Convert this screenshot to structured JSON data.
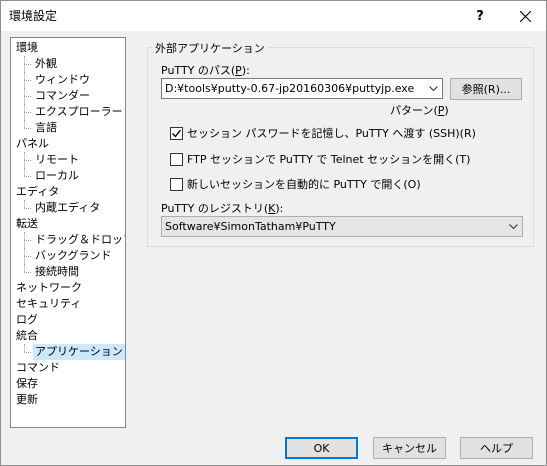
{
  "window": {
    "title": "環境設定",
    "help_glyph": "?"
  },
  "tree": [
    {
      "label": "環境",
      "level": 0
    },
    {
      "label": "外観",
      "level": 1
    },
    {
      "label": "ウィンドウ",
      "level": 1
    },
    {
      "label": "コマンダー",
      "level": 1
    },
    {
      "label": "エクスプローラー",
      "level": 1
    },
    {
      "label": "言語",
      "level": 1
    },
    {
      "label": "パネル",
      "level": 0
    },
    {
      "label": "リモート",
      "level": 1
    },
    {
      "label": "ローカル",
      "level": 1
    },
    {
      "label": "エディタ",
      "level": 0
    },
    {
      "label": "内蔵エディタ",
      "level": 1
    },
    {
      "label": "転送",
      "level": 0
    },
    {
      "label": "ドラッグ＆ドロップ",
      "level": 1
    },
    {
      "label": "バックグランド",
      "level": 1
    },
    {
      "label": "接続時間",
      "level": 1
    },
    {
      "label": "ネットワーク",
      "level": 0
    },
    {
      "label": "セキュリティ",
      "level": 0
    },
    {
      "label": "ログ",
      "level": 0
    },
    {
      "label": "統合",
      "level": 0
    },
    {
      "label": "アプリケーション",
      "level": 1,
      "selected": true
    },
    {
      "label": "コマンド",
      "level": 0
    },
    {
      "label": "保存",
      "level": 0
    },
    {
      "label": "更新",
      "level": 0
    }
  ],
  "external_apps": {
    "group_title": "外部アプリケーション",
    "putty_path_label_pre": "PuTTY のパス(",
    "putty_path_label_key": "P",
    "putty_path_label_post": "):",
    "putty_path_value": "D:¥tools¥putty-0.67-jp20160306¥puttyjp.exe",
    "browse_button": "参照(R)...",
    "pattern_link_pre": "パターン(",
    "pattern_link_key": "P",
    "pattern_link_post": ")",
    "checkboxes": [
      {
        "label": "セッション パスワードを記憶し、PuTTY へ渡す (SSH)(R)",
        "checked": true
      },
      {
        "label": "FTP セッションで PuTTY で Telnet セッションを開く(T)",
        "checked": false
      },
      {
        "label": "新しいセッションを自動的に PuTTY で開く(O)",
        "checked": false
      }
    ],
    "registry_label_pre": "PuTTY のレジストリ(",
    "registry_label_key": "K",
    "registry_label_post": "):",
    "registry_value": "Software¥SimonTatham¥PuTTY"
  },
  "footer": {
    "ok": "OK",
    "cancel": "キャンセル",
    "help": "ヘルプ"
  }
}
